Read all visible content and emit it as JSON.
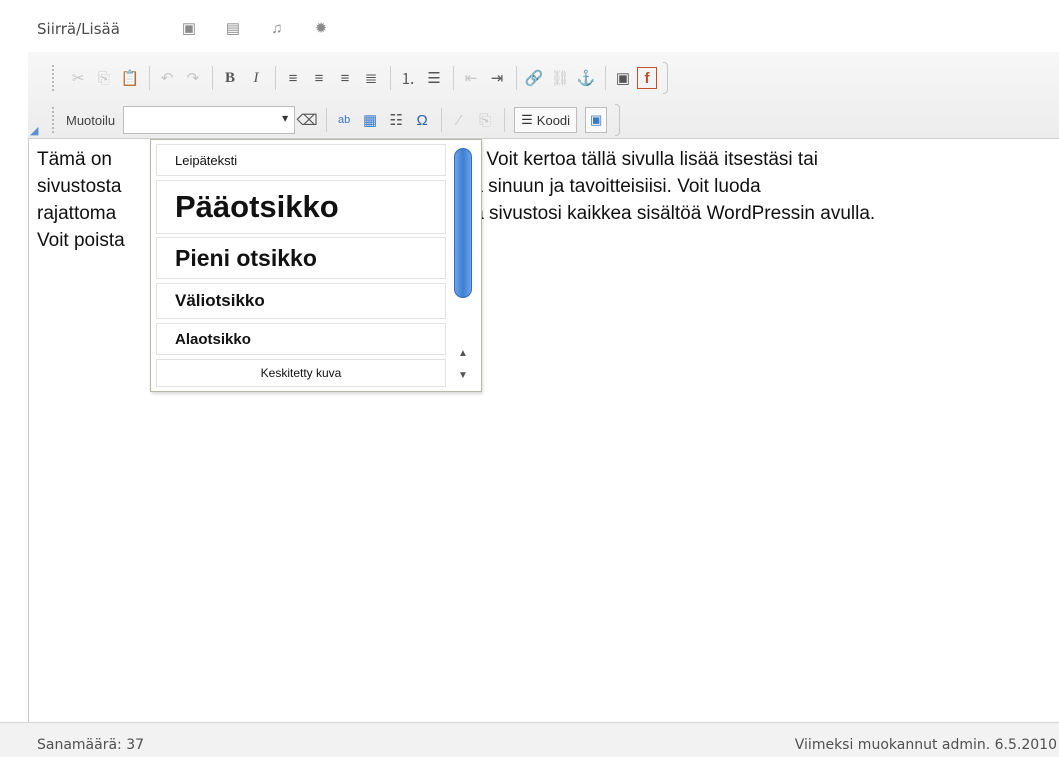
{
  "media": {
    "label": "Siirrä/Lisää",
    "icons": [
      "image-icon",
      "video-icon",
      "audio-icon",
      "media-icon"
    ]
  },
  "toolbar": {
    "row1": [
      {
        "name": "cut-icon",
        "glyph": "✂",
        "disabled": true
      },
      {
        "name": "copy-icon",
        "glyph": "⎘",
        "disabled": true
      },
      {
        "name": "paste-icon",
        "glyph": "📋",
        "disabled": false
      },
      {
        "name": "undo-icon",
        "glyph": "↶",
        "disabled": true
      },
      {
        "name": "redo-icon",
        "glyph": "↷",
        "disabled": true
      },
      {
        "name": "bold-icon",
        "glyph": "B",
        "disabled": false
      },
      {
        "name": "italic-icon",
        "glyph": "I",
        "disabled": false
      },
      {
        "name": "align-left-icon",
        "glyph": "≡",
        "disabled": false
      },
      {
        "name": "align-center-icon",
        "glyph": "≡",
        "disabled": false
      },
      {
        "name": "align-right-icon",
        "glyph": "≡",
        "disabled": false
      },
      {
        "name": "align-justify-icon",
        "glyph": "≣",
        "disabled": false
      },
      {
        "name": "numbered-list-icon",
        "glyph": "⒈",
        "disabled": false
      },
      {
        "name": "bullet-list-icon",
        "glyph": "☰",
        "disabled": false
      },
      {
        "name": "outdent-icon",
        "glyph": "⇤",
        "disabled": true
      },
      {
        "name": "indent-icon",
        "glyph": "⇥",
        "disabled": false
      },
      {
        "name": "link-icon",
        "glyph": "🔗",
        "disabled": false
      },
      {
        "name": "unlink-icon",
        "glyph": "⛓",
        "disabled": true
      },
      {
        "name": "anchor-icon",
        "glyph": "⚓",
        "disabled": false
      },
      {
        "name": "insert-image-icon",
        "glyph": "▣",
        "disabled": false
      },
      {
        "name": "facebook-icon",
        "glyph": "f",
        "disabled": false
      }
    ],
    "format_label": "Muotoilu",
    "format_value": "",
    "code_label": "Koodi"
  },
  "dropdown": {
    "items": [
      "Leipäteksti",
      "Pääotsikko",
      "Pieni otsikko",
      "Väliotsikko",
      "Alaotsikko",
      "Keskitetty kuva"
    ]
  },
  "content": {
    "line1_a": "Tämä on ",
    "line1_b": "ista. Voit kertoa tällä sivulla lisää itsestäsi tai",
    "line2_a": "sivustosta",
    "line2_b": "tua sinuun ja tavoitteisiisi. Voit luoda",
    "line3_a": "rajattoma",
    "line3_b": "a sivustosi kaikkea sisältöä WordPressin avulla.",
    "line4_a": "Voit poista"
  },
  "status": {
    "word_count": "Sanamäärä: 37",
    "last_modified": "Viimeksi muokannut admin. 6.5.2010"
  }
}
